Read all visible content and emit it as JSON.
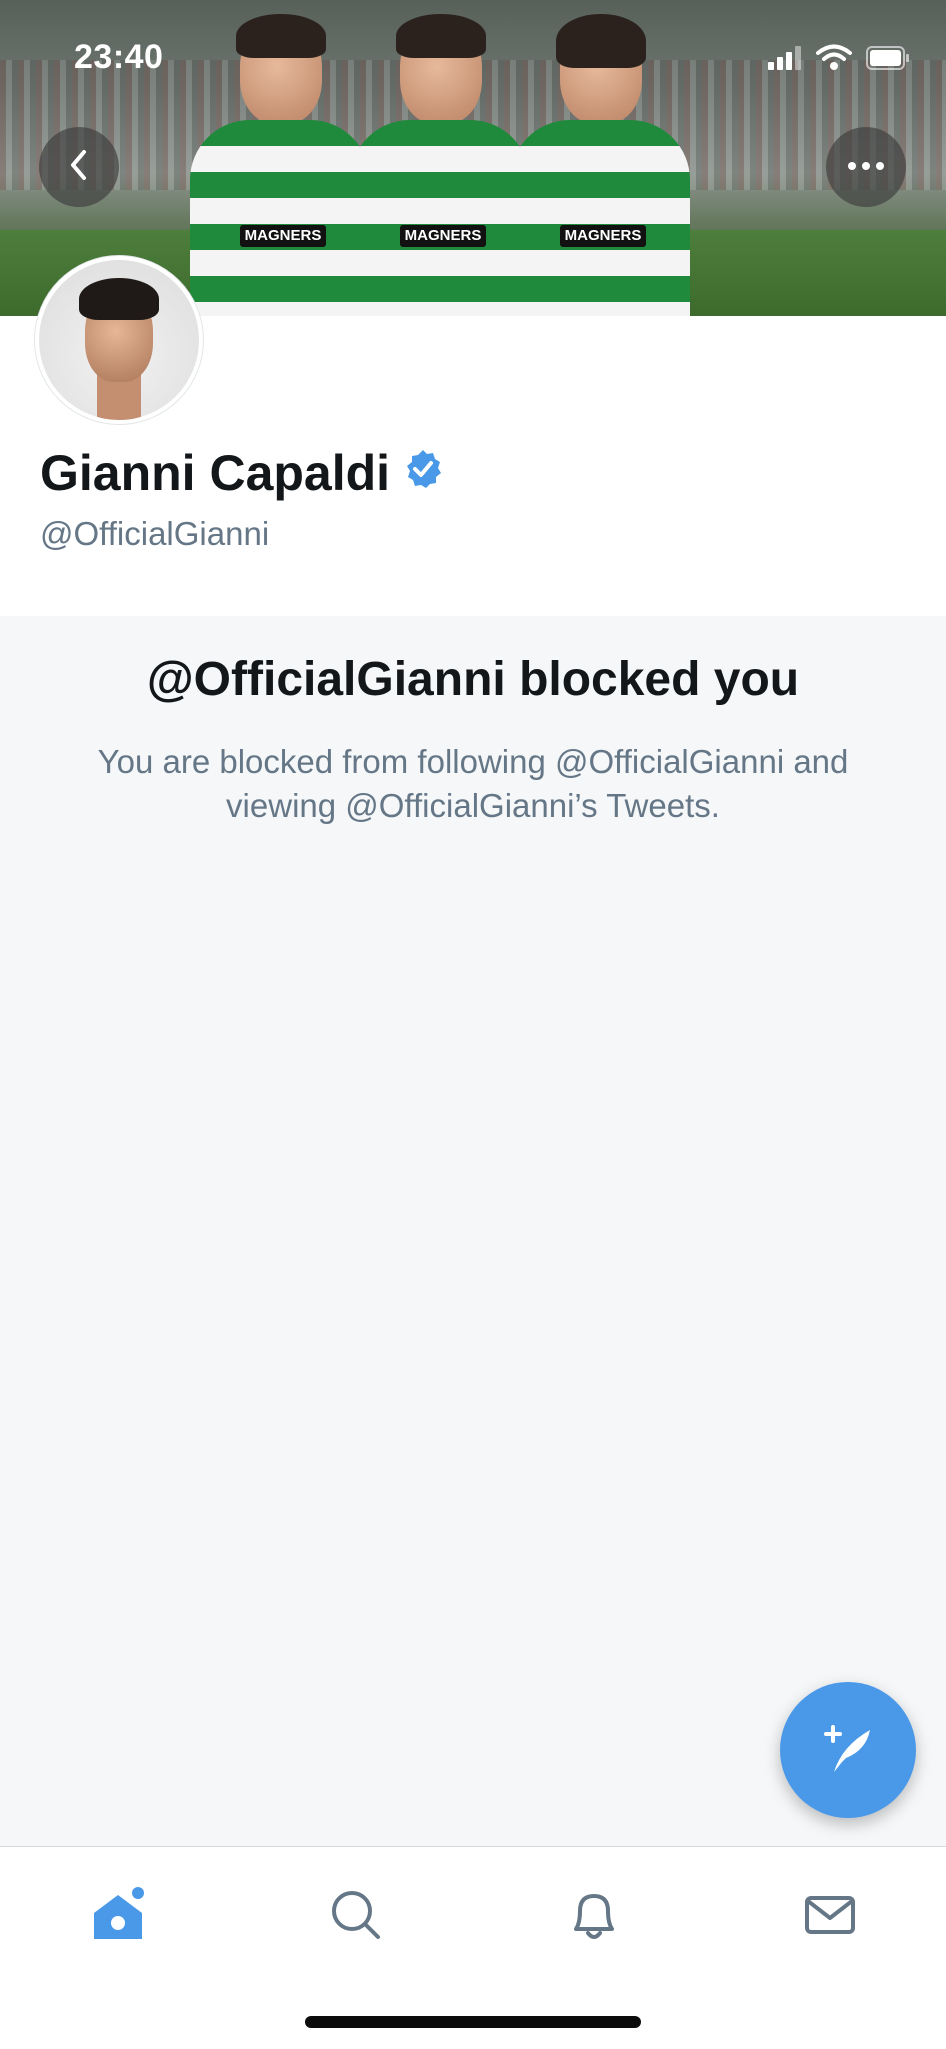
{
  "status_bar": {
    "time": "23:40"
  },
  "banner": {
    "sponsor_labels": [
      "MAGNERS",
      "MAGNERS",
      "MAGNERS"
    ]
  },
  "header": {
    "back_icon": "chevron-left-icon",
    "more_icon": "ellipsis-icon"
  },
  "profile": {
    "display_name": "Gianni Capaldi",
    "handle": "@OfficialGianni",
    "verified": true,
    "verified_color": "#4a99e9"
  },
  "blocked": {
    "title": "@OfficialGianni blocked you",
    "body": "You are blocked from following @OfficialGianni and viewing @OfficialGianni’s Tweets."
  },
  "fab": {
    "icon": "compose-tweet-icon",
    "color": "#4a99e9"
  },
  "tabbar": {
    "tabs": [
      {
        "name": "home",
        "icon": "home-icon",
        "active": true,
        "has_dot": true
      },
      {
        "name": "search",
        "icon": "search-icon",
        "active": false
      },
      {
        "name": "notifications",
        "icon": "bell-icon",
        "active": false
      },
      {
        "name": "messages",
        "icon": "envelope-icon",
        "active": false
      }
    ],
    "active_color": "#4a99e9",
    "inactive_color": "#657786"
  }
}
